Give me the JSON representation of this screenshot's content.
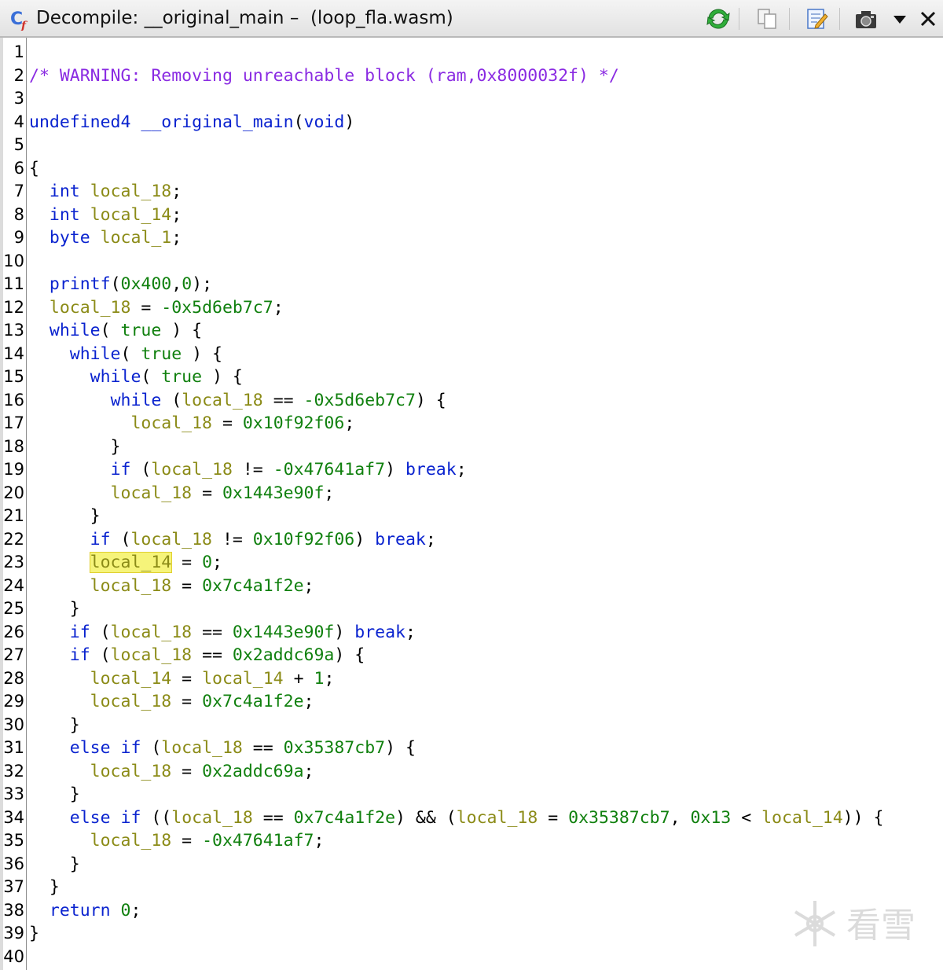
{
  "window": {
    "title": "Decompile: __original_main –  (loop_fla.wasm)"
  },
  "toolbar": {
    "buttons": [
      {
        "name": "refresh-icon"
      },
      {
        "name": "copy-icon"
      },
      {
        "name": "edit-icon"
      },
      {
        "name": "snapshot-icon"
      },
      {
        "name": "dropdown-menu-icon"
      },
      {
        "name": "close-icon"
      }
    ]
  },
  "colors": {
    "keyword": "#0a23cf",
    "variable": "#8b8b17",
    "number": "#10800e",
    "comment": "#8a2be2",
    "highlight": "#f6f47a"
  },
  "code": {
    "lines": [
      {
        "n": "1",
        "tokens": []
      },
      {
        "n": "2",
        "tokens": [
          {
            "t": "/* WARNING: Removing unreachable block (ram,0x8000032f) */",
            "c": "cmt"
          }
        ]
      },
      {
        "n": "3",
        "tokens": []
      },
      {
        "n": "4",
        "tokens": [
          {
            "t": "undefined4",
            "c": "kw"
          },
          {
            "t": " "
          },
          {
            "t": "__original_main",
            "c": "fn"
          },
          {
            "t": "("
          },
          {
            "t": "void",
            "c": "kw"
          },
          {
            "t": ")"
          }
        ]
      },
      {
        "n": "5",
        "tokens": []
      },
      {
        "n": "6",
        "tokens": [
          {
            "t": "{"
          }
        ]
      },
      {
        "n": "7",
        "tokens": [
          {
            "t": "  "
          },
          {
            "t": "int",
            "c": "kw"
          },
          {
            "t": " "
          },
          {
            "t": "local_18",
            "c": "var"
          },
          {
            "t": ";"
          }
        ]
      },
      {
        "n": "8",
        "tokens": [
          {
            "t": "  "
          },
          {
            "t": "int",
            "c": "kw"
          },
          {
            "t": " "
          },
          {
            "t": "local_14",
            "c": "var"
          },
          {
            "t": ";"
          }
        ]
      },
      {
        "n": "9",
        "tokens": [
          {
            "t": "  "
          },
          {
            "t": "byte",
            "c": "kw"
          },
          {
            "t": " "
          },
          {
            "t": "local_1",
            "c": "var"
          },
          {
            "t": ";"
          }
        ]
      },
      {
        "n": "10",
        "tokens": []
      },
      {
        "n": "11",
        "tokens": [
          {
            "t": "  "
          },
          {
            "t": "printf",
            "c": "fn"
          },
          {
            "t": "("
          },
          {
            "t": "0x400",
            "c": "num"
          },
          {
            "t": ","
          },
          {
            "t": "0",
            "c": "num"
          },
          {
            "t": ");"
          }
        ]
      },
      {
        "n": "12",
        "tokens": [
          {
            "t": "  "
          },
          {
            "t": "local_18",
            "c": "var"
          },
          {
            "t": " = "
          },
          {
            "t": "-0x5d6eb7c7",
            "c": "num"
          },
          {
            "t": ";"
          }
        ]
      },
      {
        "n": "13",
        "tokens": [
          {
            "t": "  "
          },
          {
            "t": "while",
            "c": "kw"
          },
          {
            "t": "( "
          },
          {
            "t": "true",
            "c": "num"
          },
          {
            "t": " ) {"
          }
        ]
      },
      {
        "n": "14",
        "tokens": [
          {
            "t": "    "
          },
          {
            "t": "while",
            "c": "kw"
          },
          {
            "t": "( "
          },
          {
            "t": "true",
            "c": "num"
          },
          {
            "t": " ) {"
          }
        ]
      },
      {
        "n": "15",
        "tokens": [
          {
            "t": "      "
          },
          {
            "t": "while",
            "c": "kw"
          },
          {
            "t": "( "
          },
          {
            "t": "true",
            "c": "num"
          },
          {
            "t": " ) {"
          }
        ]
      },
      {
        "n": "16",
        "tokens": [
          {
            "t": "        "
          },
          {
            "t": "while",
            "c": "kw"
          },
          {
            "t": " ("
          },
          {
            "t": "local_18",
            "c": "var"
          },
          {
            "t": " == "
          },
          {
            "t": "-0x5d6eb7c7",
            "c": "num"
          },
          {
            "t": ") {"
          }
        ]
      },
      {
        "n": "17",
        "tokens": [
          {
            "t": "          "
          },
          {
            "t": "local_18",
            "c": "var"
          },
          {
            "t": " = "
          },
          {
            "t": "0x10f92f06",
            "c": "num"
          },
          {
            "t": ";"
          }
        ]
      },
      {
        "n": "18",
        "tokens": [
          {
            "t": "        }"
          }
        ]
      },
      {
        "n": "19",
        "tokens": [
          {
            "t": "        "
          },
          {
            "t": "if",
            "c": "kw"
          },
          {
            "t": " ("
          },
          {
            "t": "local_18",
            "c": "var"
          },
          {
            "t": " != "
          },
          {
            "t": "-0x47641af7",
            "c": "num"
          },
          {
            "t": ") "
          },
          {
            "t": "break",
            "c": "kw"
          },
          {
            "t": ";"
          }
        ]
      },
      {
        "n": "20",
        "tokens": [
          {
            "t": "        "
          },
          {
            "t": "local_18",
            "c": "var"
          },
          {
            "t": " = "
          },
          {
            "t": "0x1443e90f",
            "c": "num"
          },
          {
            "t": ";"
          }
        ]
      },
      {
        "n": "21",
        "tokens": [
          {
            "t": "      }"
          }
        ]
      },
      {
        "n": "22",
        "tokens": [
          {
            "t": "      "
          },
          {
            "t": "if",
            "c": "kw"
          },
          {
            "t": " ("
          },
          {
            "t": "local_18",
            "c": "var"
          },
          {
            "t": " != "
          },
          {
            "t": "0x10f92f06",
            "c": "num"
          },
          {
            "t": ") "
          },
          {
            "t": "break",
            "c": "kw"
          },
          {
            "t": ";"
          }
        ]
      },
      {
        "n": "23",
        "tokens": [
          {
            "t": "      "
          },
          {
            "t": "local_14",
            "c": "var hl"
          },
          {
            "t": " = "
          },
          {
            "t": "0",
            "c": "num"
          },
          {
            "t": ";"
          }
        ]
      },
      {
        "n": "24",
        "tokens": [
          {
            "t": "      "
          },
          {
            "t": "local_18",
            "c": "var"
          },
          {
            "t": " = "
          },
          {
            "t": "0x7c4a1f2e",
            "c": "num"
          },
          {
            "t": ";"
          }
        ]
      },
      {
        "n": "25",
        "tokens": [
          {
            "t": "    }"
          }
        ]
      },
      {
        "n": "26",
        "tokens": [
          {
            "t": "    "
          },
          {
            "t": "if",
            "c": "kw"
          },
          {
            "t": " ("
          },
          {
            "t": "local_18",
            "c": "var"
          },
          {
            "t": " == "
          },
          {
            "t": "0x1443e90f",
            "c": "num"
          },
          {
            "t": ") "
          },
          {
            "t": "break",
            "c": "kw"
          },
          {
            "t": ";"
          }
        ]
      },
      {
        "n": "27",
        "tokens": [
          {
            "t": "    "
          },
          {
            "t": "if",
            "c": "kw"
          },
          {
            "t": " ("
          },
          {
            "t": "local_18",
            "c": "var"
          },
          {
            "t": " == "
          },
          {
            "t": "0x2addc69a",
            "c": "num"
          },
          {
            "t": ") {"
          }
        ]
      },
      {
        "n": "28",
        "tokens": [
          {
            "t": "      "
          },
          {
            "t": "local_14",
            "c": "var"
          },
          {
            "t": " = "
          },
          {
            "t": "local_14",
            "c": "var"
          },
          {
            "t": " + "
          },
          {
            "t": "1",
            "c": "num"
          },
          {
            "t": ";"
          }
        ]
      },
      {
        "n": "29",
        "tokens": [
          {
            "t": "      "
          },
          {
            "t": "local_18",
            "c": "var"
          },
          {
            "t": " = "
          },
          {
            "t": "0x7c4a1f2e",
            "c": "num"
          },
          {
            "t": ";"
          }
        ]
      },
      {
        "n": "30",
        "tokens": [
          {
            "t": "    }"
          }
        ]
      },
      {
        "n": "31",
        "tokens": [
          {
            "t": "    "
          },
          {
            "t": "else",
            "c": "kw"
          },
          {
            "t": " "
          },
          {
            "t": "if",
            "c": "kw"
          },
          {
            "t": " ("
          },
          {
            "t": "local_18",
            "c": "var"
          },
          {
            "t": " == "
          },
          {
            "t": "0x35387cb7",
            "c": "num"
          },
          {
            "t": ") {"
          }
        ]
      },
      {
        "n": "32",
        "tokens": [
          {
            "t": "      "
          },
          {
            "t": "local_18",
            "c": "var"
          },
          {
            "t": " = "
          },
          {
            "t": "0x2addc69a",
            "c": "num"
          },
          {
            "t": ";"
          }
        ]
      },
      {
        "n": "33",
        "tokens": [
          {
            "t": "    }"
          }
        ]
      },
      {
        "n": "34",
        "tokens": [
          {
            "t": "    "
          },
          {
            "t": "else",
            "c": "kw"
          },
          {
            "t": " "
          },
          {
            "t": "if",
            "c": "kw"
          },
          {
            "t": " (("
          },
          {
            "t": "local_18",
            "c": "var"
          },
          {
            "t": " == "
          },
          {
            "t": "0x7c4a1f2e",
            "c": "num"
          },
          {
            "t": ") && ("
          },
          {
            "t": "local_18",
            "c": "var"
          },
          {
            "t": " = "
          },
          {
            "t": "0x35387cb7",
            "c": "num"
          },
          {
            "t": ", "
          },
          {
            "t": "0x13",
            "c": "num"
          },
          {
            "t": " < "
          },
          {
            "t": "local_14",
            "c": "var"
          },
          {
            "t": ")) {"
          }
        ]
      },
      {
        "n": "35",
        "tokens": [
          {
            "t": "      "
          },
          {
            "t": "local_18",
            "c": "var"
          },
          {
            "t": " = "
          },
          {
            "t": "-0x47641af7",
            "c": "num"
          },
          {
            "t": ";"
          }
        ]
      },
      {
        "n": "36",
        "tokens": [
          {
            "t": "    }"
          }
        ]
      },
      {
        "n": "37",
        "tokens": [
          {
            "t": "  }"
          }
        ]
      },
      {
        "n": "38",
        "tokens": [
          {
            "t": "  "
          },
          {
            "t": "return",
            "c": "kw"
          },
          {
            "t": " "
          },
          {
            "t": "0",
            "c": "num"
          },
          {
            "t": ";"
          }
        ]
      },
      {
        "n": "39",
        "tokens": [
          {
            "t": "}"
          }
        ]
      },
      {
        "n": "40",
        "tokens": []
      }
    ]
  },
  "watermark": {
    "text": "看雪"
  }
}
